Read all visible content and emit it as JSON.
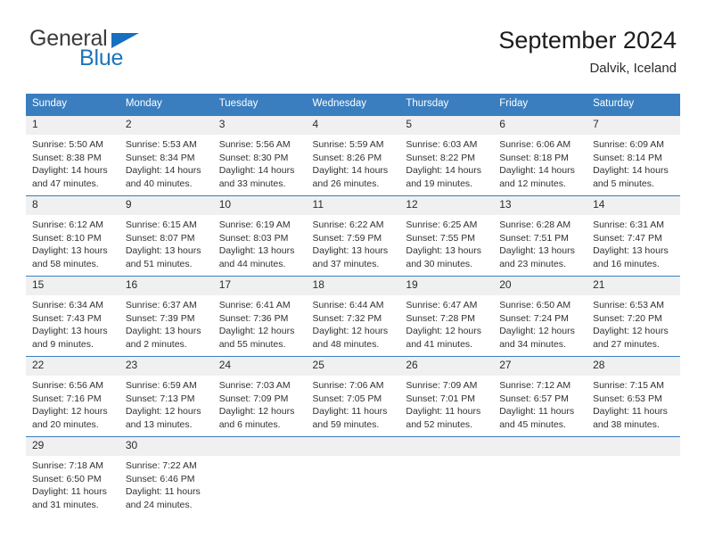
{
  "brand": {
    "name_part1": "General",
    "name_part2": "Blue",
    "triangle_icon": "triangle-icon",
    "accent_color": "#1b75bc"
  },
  "header": {
    "title": "September 2024",
    "location": "Dalvik, Iceland"
  },
  "theme": {
    "header_blue": "#3a7ebf",
    "daynum_band": "#f0f0f0",
    "text": "#303030"
  },
  "calendar": {
    "weekday_headers": [
      "Sunday",
      "Monday",
      "Tuesday",
      "Wednesday",
      "Thursday",
      "Friday",
      "Saturday"
    ],
    "weeks": [
      [
        {
          "day": "1",
          "sunrise": "Sunrise: 5:50 AM",
          "sunset": "Sunset: 8:38 PM",
          "daylight1": "Daylight: 14 hours",
          "daylight2": "and 47 minutes."
        },
        {
          "day": "2",
          "sunrise": "Sunrise: 5:53 AM",
          "sunset": "Sunset: 8:34 PM",
          "daylight1": "Daylight: 14 hours",
          "daylight2": "and 40 minutes."
        },
        {
          "day": "3",
          "sunrise": "Sunrise: 5:56 AM",
          "sunset": "Sunset: 8:30 PM",
          "daylight1": "Daylight: 14 hours",
          "daylight2": "and 33 minutes."
        },
        {
          "day": "4",
          "sunrise": "Sunrise: 5:59 AM",
          "sunset": "Sunset: 8:26 PM",
          "daylight1": "Daylight: 14 hours",
          "daylight2": "and 26 minutes."
        },
        {
          "day": "5",
          "sunrise": "Sunrise: 6:03 AM",
          "sunset": "Sunset: 8:22 PM",
          "daylight1": "Daylight: 14 hours",
          "daylight2": "and 19 minutes."
        },
        {
          "day": "6",
          "sunrise": "Sunrise: 6:06 AM",
          "sunset": "Sunset: 8:18 PM",
          "daylight1": "Daylight: 14 hours",
          "daylight2": "and 12 minutes."
        },
        {
          "day": "7",
          "sunrise": "Sunrise: 6:09 AM",
          "sunset": "Sunset: 8:14 PM",
          "daylight1": "Daylight: 14 hours",
          "daylight2": "and 5 minutes."
        }
      ],
      [
        {
          "day": "8",
          "sunrise": "Sunrise: 6:12 AM",
          "sunset": "Sunset: 8:10 PM",
          "daylight1": "Daylight: 13 hours",
          "daylight2": "and 58 minutes."
        },
        {
          "day": "9",
          "sunrise": "Sunrise: 6:15 AM",
          "sunset": "Sunset: 8:07 PM",
          "daylight1": "Daylight: 13 hours",
          "daylight2": "and 51 minutes."
        },
        {
          "day": "10",
          "sunrise": "Sunrise: 6:19 AM",
          "sunset": "Sunset: 8:03 PM",
          "daylight1": "Daylight: 13 hours",
          "daylight2": "and 44 minutes."
        },
        {
          "day": "11",
          "sunrise": "Sunrise: 6:22 AM",
          "sunset": "Sunset: 7:59 PM",
          "daylight1": "Daylight: 13 hours",
          "daylight2": "and 37 minutes."
        },
        {
          "day": "12",
          "sunrise": "Sunrise: 6:25 AM",
          "sunset": "Sunset: 7:55 PM",
          "daylight1": "Daylight: 13 hours",
          "daylight2": "and 30 minutes."
        },
        {
          "day": "13",
          "sunrise": "Sunrise: 6:28 AM",
          "sunset": "Sunset: 7:51 PM",
          "daylight1": "Daylight: 13 hours",
          "daylight2": "and 23 minutes."
        },
        {
          "day": "14",
          "sunrise": "Sunrise: 6:31 AM",
          "sunset": "Sunset: 7:47 PM",
          "daylight1": "Daylight: 13 hours",
          "daylight2": "and 16 minutes."
        }
      ],
      [
        {
          "day": "15",
          "sunrise": "Sunrise: 6:34 AM",
          "sunset": "Sunset: 7:43 PM",
          "daylight1": "Daylight: 13 hours",
          "daylight2": "and 9 minutes."
        },
        {
          "day": "16",
          "sunrise": "Sunrise: 6:37 AM",
          "sunset": "Sunset: 7:39 PM",
          "daylight1": "Daylight: 13 hours",
          "daylight2": "and 2 minutes."
        },
        {
          "day": "17",
          "sunrise": "Sunrise: 6:41 AM",
          "sunset": "Sunset: 7:36 PM",
          "daylight1": "Daylight: 12 hours",
          "daylight2": "and 55 minutes."
        },
        {
          "day": "18",
          "sunrise": "Sunrise: 6:44 AM",
          "sunset": "Sunset: 7:32 PM",
          "daylight1": "Daylight: 12 hours",
          "daylight2": "and 48 minutes."
        },
        {
          "day": "19",
          "sunrise": "Sunrise: 6:47 AM",
          "sunset": "Sunset: 7:28 PM",
          "daylight1": "Daylight: 12 hours",
          "daylight2": "and 41 minutes."
        },
        {
          "day": "20",
          "sunrise": "Sunrise: 6:50 AM",
          "sunset": "Sunset: 7:24 PM",
          "daylight1": "Daylight: 12 hours",
          "daylight2": "and 34 minutes."
        },
        {
          "day": "21",
          "sunrise": "Sunrise: 6:53 AM",
          "sunset": "Sunset: 7:20 PM",
          "daylight1": "Daylight: 12 hours",
          "daylight2": "and 27 minutes."
        }
      ],
      [
        {
          "day": "22",
          "sunrise": "Sunrise: 6:56 AM",
          "sunset": "Sunset: 7:16 PM",
          "daylight1": "Daylight: 12 hours",
          "daylight2": "and 20 minutes."
        },
        {
          "day": "23",
          "sunrise": "Sunrise: 6:59 AM",
          "sunset": "Sunset: 7:13 PM",
          "daylight1": "Daylight: 12 hours",
          "daylight2": "and 13 minutes."
        },
        {
          "day": "24",
          "sunrise": "Sunrise: 7:03 AM",
          "sunset": "Sunset: 7:09 PM",
          "daylight1": "Daylight: 12 hours",
          "daylight2": "and 6 minutes."
        },
        {
          "day": "25",
          "sunrise": "Sunrise: 7:06 AM",
          "sunset": "Sunset: 7:05 PM",
          "daylight1": "Daylight: 11 hours",
          "daylight2": "and 59 minutes."
        },
        {
          "day": "26",
          "sunrise": "Sunrise: 7:09 AM",
          "sunset": "Sunset: 7:01 PM",
          "daylight1": "Daylight: 11 hours",
          "daylight2": "and 52 minutes."
        },
        {
          "day": "27",
          "sunrise": "Sunrise: 7:12 AM",
          "sunset": "Sunset: 6:57 PM",
          "daylight1": "Daylight: 11 hours",
          "daylight2": "and 45 minutes."
        },
        {
          "day": "28",
          "sunrise": "Sunrise: 7:15 AM",
          "sunset": "Sunset: 6:53 PM",
          "daylight1": "Daylight: 11 hours",
          "daylight2": "and 38 minutes."
        }
      ],
      [
        {
          "day": "29",
          "sunrise": "Sunrise: 7:18 AM",
          "sunset": "Sunset: 6:50 PM",
          "daylight1": "Daylight: 11 hours",
          "daylight2": "and 31 minutes."
        },
        {
          "day": "30",
          "sunrise": "Sunrise: 7:22 AM",
          "sunset": "Sunset: 6:46 PM",
          "daylight1": "Daylight: 11 hours",
          "daylight2": "and 24 minutes."
        },
        {
          "day": "",
          "sunrise": "",
          "sunset": "",
          "daylight1": "",
          "daylight2": "",
          "empty": true
        },
        {
          "day": "",
          "sunrise": "",
          "sunset": "",
          "daylight1": "",
          "daylight2": "",
          "empty": true
        },
        {
          "day": "",
          "sunrise": "",
          "sunset": "",
          "daylight1": "",
          "daylight2": "",
          "empty": true
        },
        {
          "day": "",
          "sunrise": "",
          "sunset": "",
          "daylight1": "",
          "daylight2": "",
          "empty": true
        },
        {
          "day": "",
          "sunrise": "",
          "sunset": "",
          "daylight1": "",
          "daylight2": "",
          "empty": true
        }
      ]
    ]
  }
}
